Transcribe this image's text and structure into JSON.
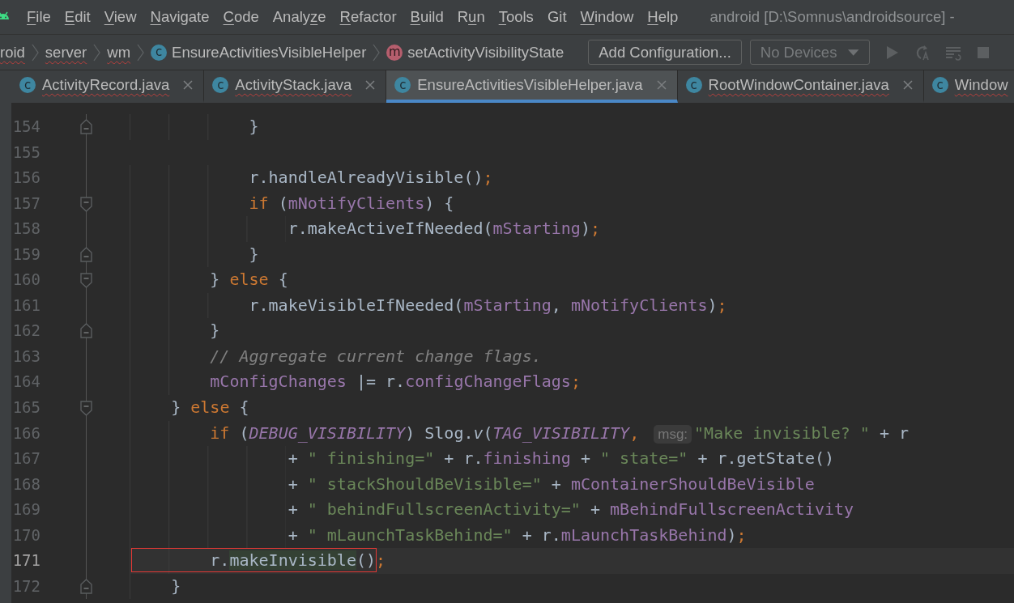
{
  "menu_bar": {
    "items": [
      {
        "key": "F",
        "after": "ile"
      },
      {
        "key": "E",
        "after": "dit"
      },
      {
        "key": "V",
        "after": "iew"
      },
      {
        "key": "N",
        "after": "avigate"
      },
      {
        "key": "C",
        "after": "ode"
      },
      {
        "before": "Analy",
        "key": "z",
        "after": "e"
      },
      {
        "key": "R",
        "after": "efactor"
      },
      {
        "key": "B",
        "after": "uild"
      },
      {
        "before": "R",
        "key": "u",
        "after": "n"
      },
      {
        "key": "T",
        "after": "ools"
      },
      {
        "before": "Git"
      },
      {
        "key": "W",
        "after": "indow"
      },
      {
        "key": "H",
        "after": "elp"
      }
    ],
    "title": "android [D:\\Somnus\\androidsource] -"
  },
  "breadcrumb": {
    "items": [
      {
        "label": "roid",
        "error": true
      },
      {
        "label": "server",
        "error": true
      },
      {
        "label": "wm",
        "error": true
      },
      {
        "label": "EnsureActivitiesVisibleHelper",
        "icon": "c",
        "error": false
      },
      {
        "label": "setActivityVisibilityState",
        "icon": "m",
        "error": false
      }
    ],
    "add_configuration": "Add Configuration...",
    "devices": {
      "label": "No Devices",
      "disabled": true
    }
  },
  "tabs": [
    {
      "label": "ActivityRecord.java",
      "icon": "c",
      "selected": false,
      "error": true
    },
    {
      "label": "ActivityStack.java",
      "icon": "c",
      "selected": false,
      "error": true
    },
    {
      "label": "EnsureActivitiesVisibleHelper.java",
      "icon": "c",
      "selected": true,
      "error": false
    },
    {
      "label": "RootWindowContainer.java",
      "icon": "c",
      "selected": false,
      "error": true
    },
    {
      "label": "Window",
      "icon": "c",
      "selected": false,
      "error": true
    }
  ],
  "editor": {
    "lines": [
      {
        "number": "154",
        "fold_start": false,
        "fold_end": true,
        "current": false,
        "tokens": [
          {
            "kind": "plain",
            "text": "            }"
          }
        ]
      },
      {
        "number": "155",
        "fold_start": false,
        "fold_end": false,
        "current": false
      },
      {
        "number": "156",
        "fold_start": false,
        "fold_end": false,
        "current": false,
        "tokens": [
          {
            "kind": "plain",
            "text": "            r.handleAlreadyVisible()"
          },
          {
            "kind": "keyword",
            "text": ";"
          }
        ]
      },
      {
        "number": "157",
        "fold_start": true,
        "fold_end": false,
        "current": false,
        "tokens": [
          {
            "kind": "keyword",
            "text": "            if"
          },
          {
            "kind": "plain",
            "text": " ("
          },
          {
            "kind": "field",
            "text": "mNotifyClients"
          },
          {
            "kind": "plain",
            "text": ") {"
          }
        ]
      },
      {
        "number": "158",
        "fold_start": false,
        "fold_end": false,
        "current": false,
        "tokens": [
          {
            "kind": "plain",
            "text": "                r.makeActiveIfNeeded("
          },
          {
            "kind": "field",
            "text": "mStarting"
          },
          {
            "kind": "plain",
            "text": ")"
          },
          {
            "kind": "keyword",
            "text": ";"
          }
        ]
      },
      {
        "number": "159",
        "fold_start": false,
        "fold_end": true,
        "current": false,
        "tokens": [
          {
            "kind": "plain",
            "text": "            }"
          }
        ]
      },
      {
        "number": "160",
        "fold_start": true,
        "fold_end": false,
        "current": false,
        "tokens": [
          {
            "kind": "plain",
            "text": "        } "
          },
          {
            "kind": "keyword",
            "text": "else"
          },
          {
            "kind": "plain",
            "text": " {"
          }
        ]
      },
      {
        "number": "161",
        "fold_start": false,
        "fold_end": false,
        "current": false,
        "tokens": [
          {
            "kind": "plain",
            "text": "            r.makeVisibleIfNeeded("
          },
          {
            "kind": "field",
            "text": "mStarting"
          },
          {
            "kind": "plain",
            "text": ", "
          },
          {
            "kind": "field",
            "text": "mNotifyClients"
          },
          {
            "kind": "plain",
            "text": ")"
          },
          {
            "kind": "keyword",
            "text": ";"
          }
        ]
      },
      {
        "number": "162",
        "fold_start": false,
        "fold_end": true,
        "current": false,
        "tokens": [
          {
            "kind": "plain",
            "text": "        }"
          }
        ]
      },
      {
        "number": "163",
        "fold_start": false,
        "fold_end": false,
        "current": false,
        "tokens": [
          {
            "kind": "comment",
            "text": "        // Aggregate current change flags."
          }
        ]
      },
      {
        "number": "164",
        "fold_start": false,
        "fold_end": false,
        "current": false,
        "tokens": [
          {
            "kind": "field",
            "text": "        mConfigChanges"
          },
          {
            "kind": "plain",
            "text": " |= r."
          },
          {
            "kind": "field",
            "text": "configChangeFlags"
          },
          {
            "kind": "keyword",
            "text": ";"
          }
        ]
      },
      {
        "number": "165",
        "fold_start": true,
        "fold_end": false,
        "current": false,
        "tokens": [
          {
            "kind": "plain",
            "text": "    } "
          },
          {
            "kind": "keyword",
            "text": "else"
          },
          {
            "kind": "plain",
            "text": " {"
          }
        ]
      },
      {
        "number": "166",
        "fold_start": false,
        "fold_end": false,
        "current": false,
        "tokens": [
          {
            "kind": "keyword",
            "text": "        if"
          },
          {
            "kind": "plain",
            "text": " ("
          },
          {
            "kind": "static",
            "text": "DEBUG_VISIBILITY"
          },
          {
            "kind": "plain",
            "text": ") Slog."
          },
          {
            "kind": "italic",
            "text": "v"
          },
          {
            "kind": "plain",
            "text": "("
          },
          {
            "kind": "static",
            "text": "TAG_VISIBILITY"
          },
          {
            "kind": "keyword",
            "text": ", "
          },
          {
            "kind": "hint",
            "text": "msg:"
          },
          {
            "kind": "string",
            "text": "\"Make invisible? \""
          },
          {
            "kind": "plain",
            "text": " + r"
          }
        ]
      },
      {
        "number": "167",
        "fold_start": false,
        "fold_end": false,
        "current": false,
        "tokens": [
          {
            "kind": "plain",
            "text": "                + "
          },
          {
            "kind": "string",
            "text": "\" finishing=\""
          },
          {
            "kind": "plain",
            "text": " + r."
          },
          {
            "kind": "field",
            "text": "finishing"
          },
          {
            "kind": "plain",
            "text": " + "
          },
          {
            "kind": "string",
            "text": "\" state=\""
          },
          {
            "kind": "plain",
            "text": " + r.getState()"
          }
        ]
      },
      {
        "number": "168",
        "fold_start": false,
        "fold_end": false,
        "current": false,
        "tokens": [
          {
            "kind": "plain",
            "text": "                + "
          },
          {
            "kind": "string",
            "text": "\" stackShouldBeVisible=\""
          },
          {
            "kind": "plain",
            "text": " + "
          },
          {
            "kind": "field",
            "text": "mContainerShouldBeVisible"
          }
        ]
      },
      {
        "number": "169",
        "fold_start": false,
        "fold_end": false,
        "current": false,
        "tokens": [
          {
            "kind": "plain",
            "text": "                + "
          },
          {
            "kind": "string",
            "text": "\" behindFullscreenActivity=\""
          },
          {
            "kind": "plain",
            "text": " + "
          },
          {
            "kind": "field",
            "text": "mBehindFullscreenActivity"
          }
        ]
      },
      {
        "number": "170",
        "fold_start": false,
        "fold_end": false,
        "current": false,
        "tokens": [
          {
            "kind": "plain",
            "text": "                + "
          },
          {
            "kind": "string",
            "text": "\" mLaunchTaskBehind=\""
          },
          {
            "kind": "plain",
            "text": " + r."
          },
          {
            "kind": "field",
            "text": "mLaunchTaskBehind"
          },
          {
            "kind": "plain",
            "text": ")"
          },
          {
            "kind": "keyword",
            "text": ";"
          }
        ]
      },
      {
        "number": "171",
        "fold_start": false,
        "fold_end": false,
        "current": true,
        "tokens": [
          {
            "kind": "group",
            "boxed": true,
            "tokens": [
              {
                "kind": "plain",
                "text": "        r."
              },
              {
                "kind": "plain",
                "text": "makeInvisible",
                "highlighted": true
              },
              {
                "kind": "plain",
                "text": "()"
              }
            ]
          },
          {
            "kind": "keyword",
            "text": ";"
          }
        ]
      },
      {
        "number": "172",
        "fold_start": false,
        "fold_end": true,
        "current": false,
        "tokens": [
          {
            "kind": "plain",
            "text": "    }"
          }
        ]
      }
    ]
  }
}
